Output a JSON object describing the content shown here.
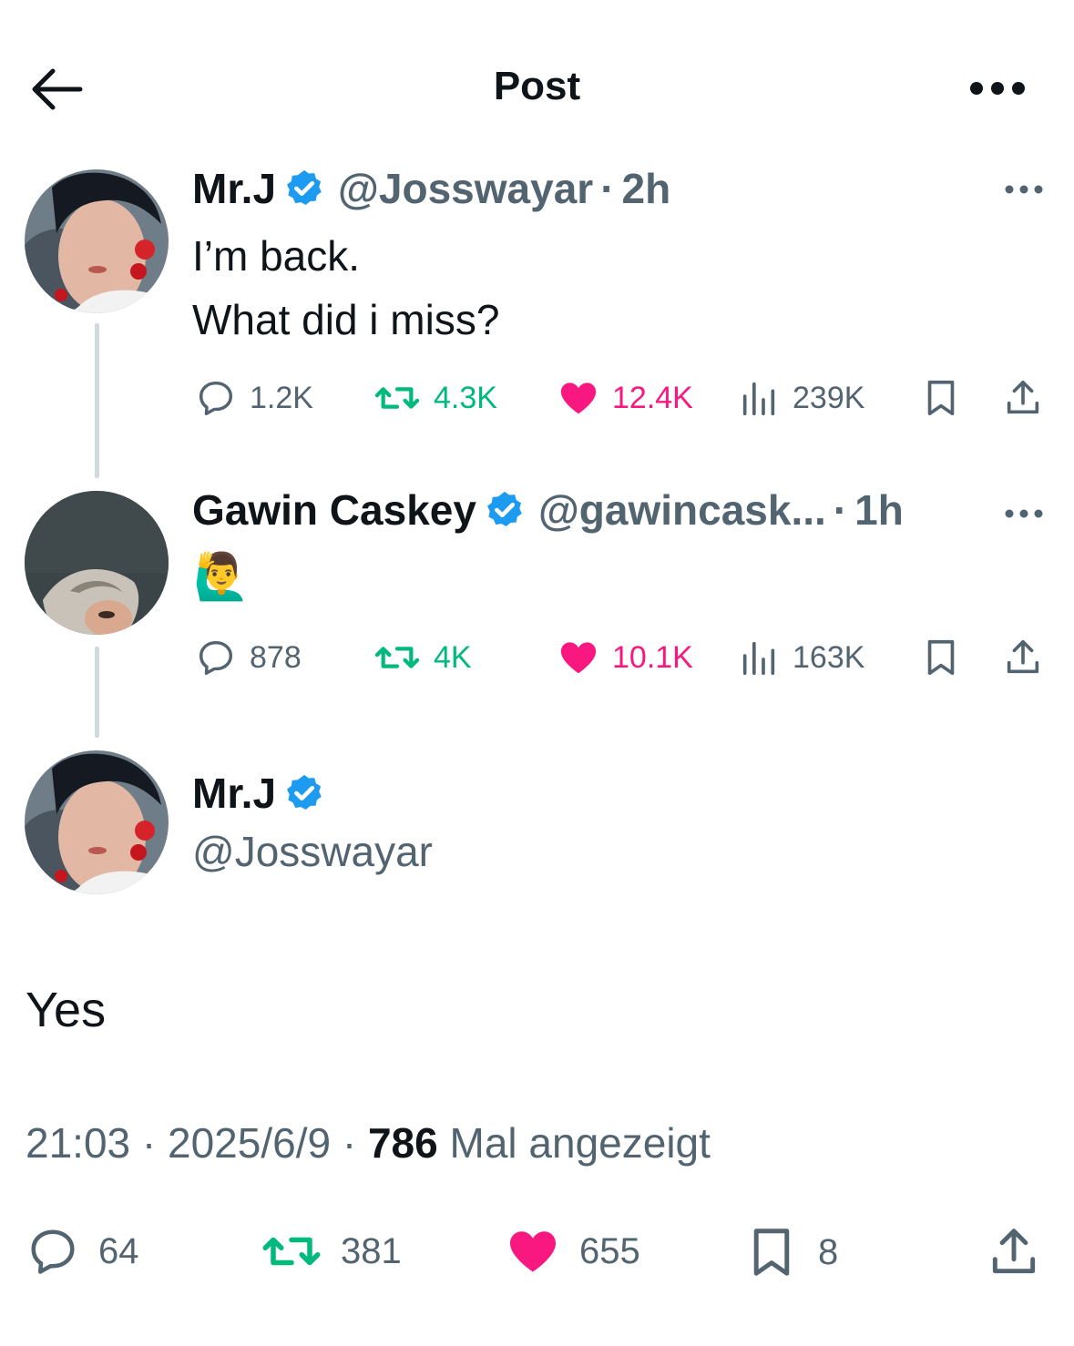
{
  "header": {
    "title": "Post"
  },
  "thread": [
    {
      "name": "Mr.J",
      "handle": "@Josswayar",
      "sep": "·",
      "time": "2h",
      "lines": [
        "I’m back.",
        "What did i miss?"
      ],
      "replies": "1.2K",
      "reposts": "4.3K",
      "likes": "12.4K",
      "views": "239K"
    },
    {
      "name": "Gawin Caskey",
      "handle": "@gawincask...",
      "sep": "·",
      "time": "1h",
      "emoji": "🙋‍♂️",
      "replies": "878",
      "reposts": "4K",
      "likes": "10.1K",
      "views": "163K"
    }
  ],
  "main": {
    "name": "Mr.J",
    "handle": "@Josswayar",
    "text": "Yes",
    "time": "21:03",
    "date": "2025/6/9",
    "views_count": "786",
    "views_label": "Mal angezeigt",
    "sep": "·",
    "replies": "64",
    "reposts": "381",
    "likes": "655",
    "bookmarks": "8"
  },
  "colors": {
    "verified": "#1d9bf0",
    "repost": "#00ba7c",
    "like": "#f91880",
    "muted": "#536471"
  }
}
